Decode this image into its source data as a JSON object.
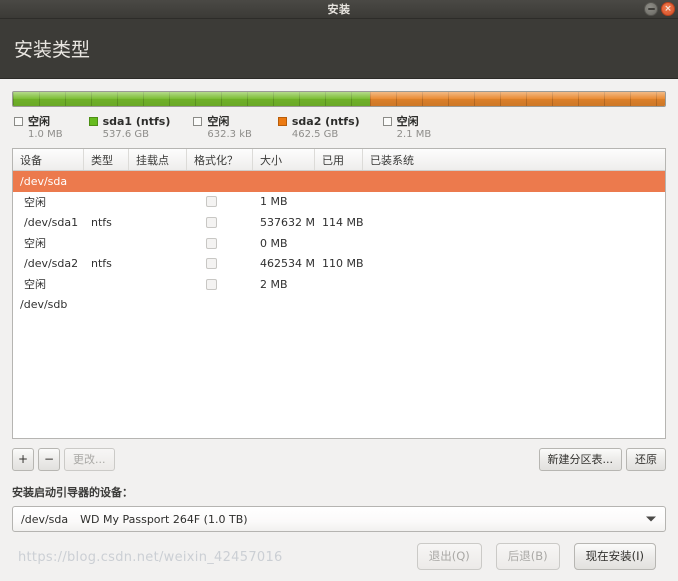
{
  "window": {
    "title": "安装",
    "minimize_icon": "minimize-icon",
    "close_icon": "close-icon",
    "close_glyph": "×"
  },
  "header": {
    "page_title": "安装类型"
  },
  "partition_bar": {
    "segments": [
      {
        "name": "sda1",
        "color": "#76bb2b",
        "percent": 54.7
      },
      {
        "name": "sda2",
        "color": "#e9882d",
        "percent": 45.3
      }
    ]
  },
  "legend": [
    {
      "label": "空闲",
      "size": "1.0 MB",
      "swatch": "empty"
    },
    {
      "label": "sda1 (ntfs)",
      "size": "537.6 GB",
      "swatch": "green"
    },
    {
      "label": "空闲",
      "size": "632.3 kB",
      "swatch": "empty"
    },
    {
      "label": "sda2 (ntfs)",
      "size": "462.5 GB",
      "swatch": "orange"
    },
    {
      "label": "空闲",
      "size": "2.1 MB",
      "swatch": "empty"
    }
  ],
  "table": {
    "columns": [
      "设备",
      "类型",
      "挂载点",
      "格式化？",
      "大小",
      "已用",
      "已装系统"
    ],
    "rows": [
      {
        "kind": "drive",
        "device": "/dev/sda",
        "type": "",
        "mount": "",
        "format": false,
        "size": "",
        "used": "",
        "system": "",
        "selected": true
      },
      {
        "kind": "partition",
        "device": "空闲",
        "type": "",
        "mount": "",
        "format": true,
        "size": "1 MB",
        "used": "",
        "system": "",
        "selected": false
      },
      {
        "kind": "partition",
        "device": "/dev/sda1",
        "type": "ntfs",
        "mount": "",
        "format": true,
        "size": "537632 MB",
        "used": "114 MB",
        "system": "",
        "selected": false
      },
      {
        "kind": "partition",
        "device": "空闲",
        "type": "",
        "mount": "",
        "format": true,
        "size": "0 MB",
        "used": "",
        "system": "",
        "selected": false
      },
      {
        "kind": "partition",
        "device": "/dev/sda2",
        "type": "ntfs",
        "mount": "",
        "format": true,
        "size": "462534 MB",
        "used": "110 MB",
        "system": "",
        "selected": false
      },
      {
        "kind": "partition",
        "device": "空闲",
        "type": "",
        "mount": "",
        "format": true,
        "size": "2 MB",
        "used": "",
        "system": "",
        "selected": false
      },
      {
        "kind": "drive",
        "device": "/dev/sdb",
        "type": "",
        "mount": "",
        "format": false,
        "size": "",
        "used": "",
        "system": "",
        "selected": false
      }
    ]
  },
  "toolbar": {
    "add_label": "+",
    "remove_label": "−",
    "change_label": "更改...",
    "new_table_label": "新建分区表...",
    "revert_label": "还原"
  },
  "bootloader": {
    "label": "安装启动引导器的设备：",
    "device": "/dev/sda",
    "description": "WD My Passport 264F (1.0 TB)",
    "arrow_icon": "chevron-down-icon"
  },
  "footer": {
    "quit_label": "退出(Q)",
    "back_label": "后退(B)",
    "install_label": "现在安装(I)",
    "watermark": "https://blog.csdn.net/weixin_42457016"
  },
  "colors": {
    "accent_orange": "#ec7a12",
    "accent_green": "#66bb1e",
    "selection": "#ec7a4d",
    "header_dark": "#3c3b37"
  }
}
